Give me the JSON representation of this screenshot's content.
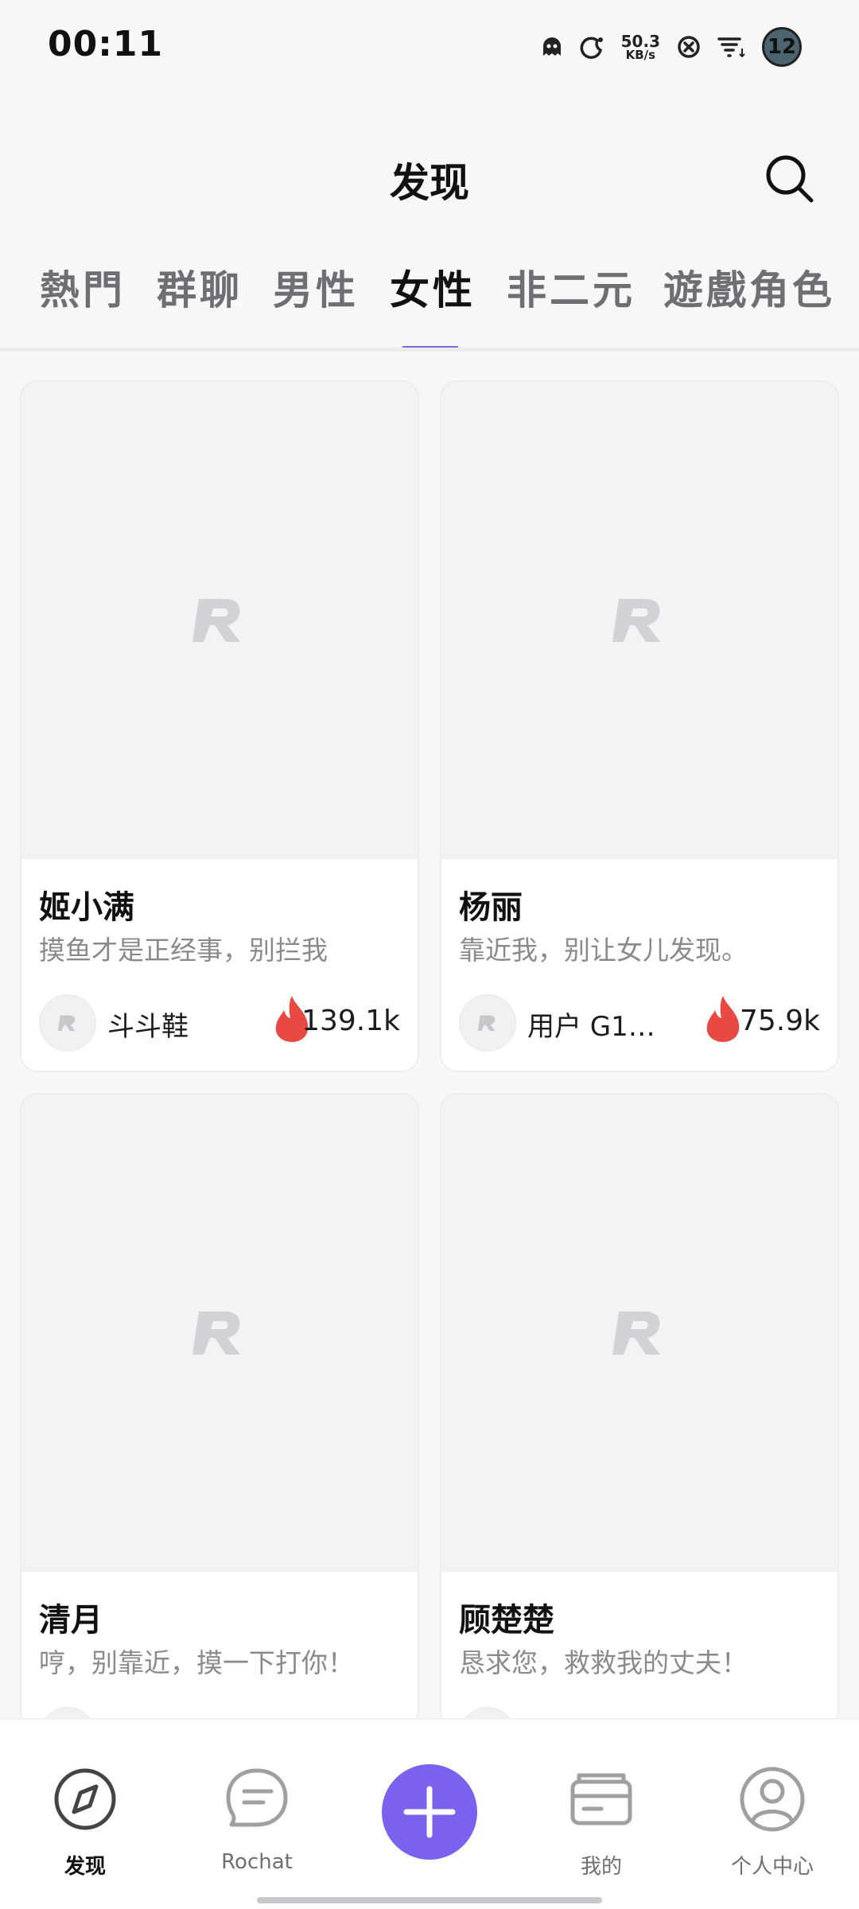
{
  "status_bar": {
    "time": "00:11",
    "net_speed_value": "50.3",
    "net_speed_unit": "KB/s",
    "notification_count": "12"
  },
  "header": {
    "title": "发现",
    "search_icon": "search-icon"
  },
  "tabs": [
    {
      "label": "熱門",
      "active": false
    },
    {
      "label": "群聊",
      "active": false
    },
    {
      "label": "男性",
      "active": false
    },
    {
      "label": "女性",
      "active": true
    },
    {
      "label": "非二元",
      "active": false
    },
    {
      "label": "遊戲角色",
      "active": false
    }
  ],
  "cards": [
    {
      "name": "姬小满",
      "description": "摸鱼才是正经事，别拦我",
      "author": "斗斗鞋",
      "count": "139.1k"
    },
    {
      "name": "杨丽",
      "description": "靠近我，别让女儿发现。",
      "author": "用户 G1a…",
      "count": "75.9k"
    },
    {
      "name": "清月",
      "description": "哼，别靠近，摸一下打你！",
      "author": "",
      "count": ""
    },
    {
      "name": "顾楚楚",
      "description": "恳求您，救救我的丈夫！",
      "author": "",
      "count": ""
    }
  ],
  "bottom_nav": [
    {
      "label": "发现",
      "icon": "compass-icon",
      "active": true
    },
    {
      "label": "Rochat",
      "icon": "chat-bubble-icon",
      "active": false
    },
    {
      "label": "",
      "icon": "plus-icon",
      "active": false
    },
    {
      "label": "我的",
      "icon": "wallet-icon",
      "active": false
    },
    {
      "label": "个人中心",
      "icon": "user-profile-icon",
      "active": false
    }
  ],
  "colors": {
    "accent": "#7a62ef",
    "tab_indicator": "#7a6bd6",
    "flame": "#e84a43"
  }
}
